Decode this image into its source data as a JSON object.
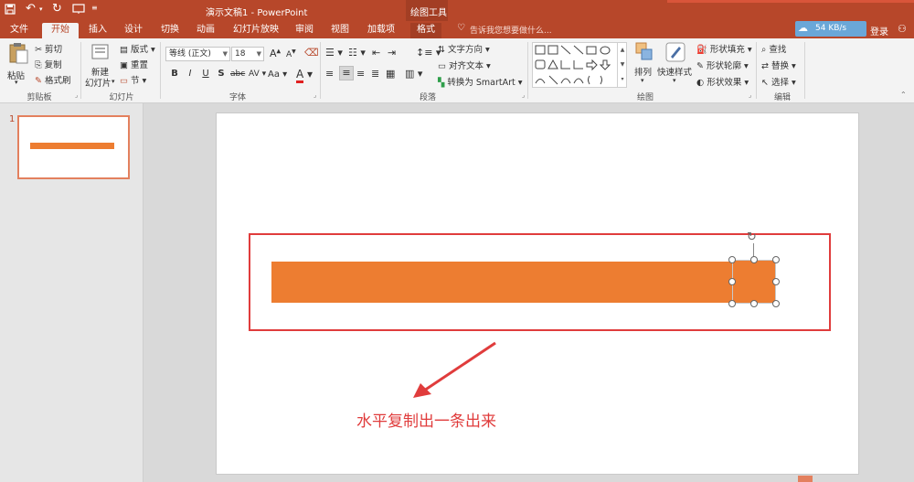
{
  "titlebar": {
    "title": "演示文稿1 - PowerPoint",
    "tool_context": "绘图工具",
    "search_placeholder": "告诉我您想要做什么...",
    "speed": "54 KB/s",
    "login": "登录"
  },
  "tabs": [
    {
      "label": "文件"
    },
    {
      "label": "开始"
    },
    {
      "label": "插入"
    },
    {
      "label": "设计"
    },
    {
      "label": "切换"
    },
    {
      "label": "动画"
    },
    {
      "label": "幻灯片放映"
    },
    {
      "label": "审阅"
    },
    {
      "label": "视图"
    },
    {
      "label": "加载项"
    },
    {
      "label": "格式"
    }
  ],
  "ribbon": {
    "clipboard": {
      "paste": "粘贴",
      "cut": "剪切",
      "copy": "复制",
      "format_painter": "格式刷",
      "label": "剪贴板"
    },
    "slides": {
      "new_slide": "新建",
      "new_slide2": "幻灯片",
      "layout": "版式",
      "reset": "重置",
      "section": "节",
      "label": "幻灯片"
    },
    "font": {
      "name": "等线 (正文)",
      "size": "18",
      "label": "字体",
      "bold": "B",
      "italic": "I",
      "underline": "U",
      "strike": "S",
      "abc": "abc",
      "spacing": "AV",
      "case": "Aa",
      "color": "A",
      "grow": "A",
      "shrink": "A"
    },
    "paragraph": {
      "text_direction": "文字方向",
      "align_text": "对齐文本",
      "smartart": "转换为 SmartArt",
      "label": "段落"
    },
    "drawing": {
      "arrange": "排列",
      "quick_styles": "快速样式",
      "fill": "形状填充",
      "outline": "形状轮廓",
      "effects": "形状效果",
      "label": "绘图"
    },
    "editing": {
      "find": "查找",
      "replace": "替换",
      "select": "选择",
      "label": "编辑"
    }
  },
  "slides_pane": {
    "number": "1"
  },
  "slide": {
    "annotation": "水平复制出一条出来"
  },
  "colors": {
    "accent": "#b7472a",
    "shape": "#ed7d31",
    "annotation": "#e03c3c"
  }
}
